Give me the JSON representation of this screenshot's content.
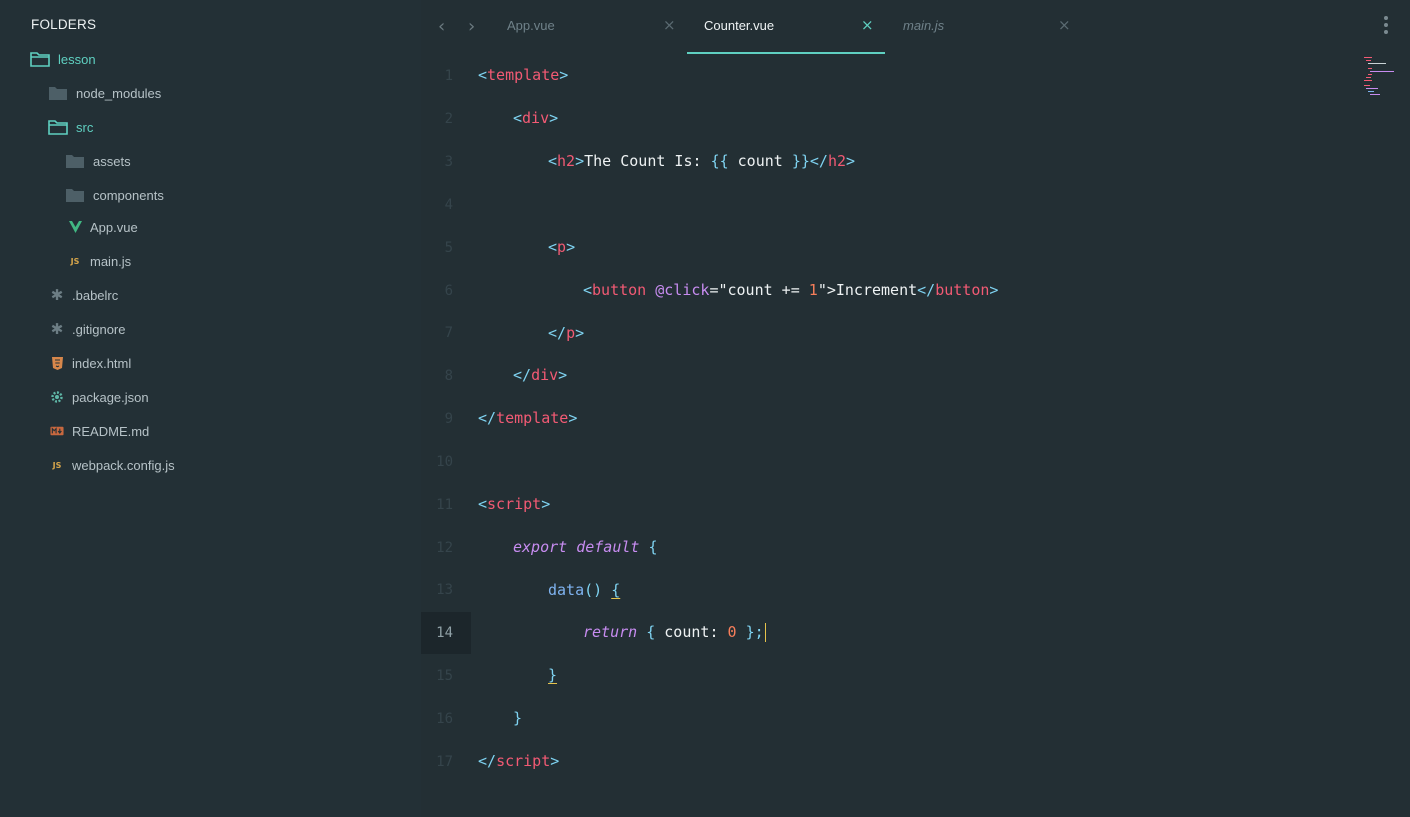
{
  "sidebar": {
    "title": "FOLDERS",
    "items": [
      {
        "label": "lesson",
        "icon": "folder-open-icon"
      },
      {
        "label": "node_modules",
        "icon": "folder-icon"
      },
      {
        "label": "src",
        "icon": "folder-open-icon"
      },
      {
        "label": "assets",
        "icon": "folder-icon"
      },
      {
        "label": "components",
        "icon": "folder-icon"
      },
      {
        "label": "App.vue",
        "icon": "vue-icon"
      },
      {
        "label": "main.js",
        "icon": "js-icon"
      },
      {
        "label": ".babelrc",
        "icon": "asterisk-icon"
      },
      {
        "label": ".gitignore",
        "icon": "asterisk-icon"
      },
      {
        "label": "index.html",
        "icon": "html5-icon"
      },
      {
        "label": "package.json",
        "icon": "gear-icon"
      },
      {
        "label": "README.md",
        "icon": "markdown-icon"
      },
      {
        "label": "webpack.config.js",
        "icon": "js-icon"
      }
    ]
  },
  "tabs": [
    {
      "label": "App.vue",
      "close": "×",
      "active": false
    },
    {
      "label": "Counter.vue",
      "close": "×",
      "active": true
    },
    {
      "label": "main.js",
      "close": "×",
      "active": false
    }
  ],
  "nav": {
    "back": "‹",
    "forward": "›"
  },
  "editor": {
    "line_numbers": [
      "1",
      "2",
      "3",
      "4",
      "5",
      "6",
      "7",
      "8",
      "9",
      "10",
      "11",
      "12",
      "13",
      "14",
      "15",
      "16",
      "17"
    ],
    "current_line": "14",
    "code": {
      "l1": {
        "a": "<",
        "b": "template",
        "c": ">"
      },
      "l2": {
        "a": "<",
        "b": "div",
        "c": ">"
      },
      "l3": {
        "a": "<",
        "b": "h2",
        "c": ">",
        "d": "The Count Is: ",
        "e": "{{",
        "f": " count ",
        "g": "}}",
        "h": "</",
        "i": "h2",
        "j": ">"
      },
      "l5": {
        "a": "<",
        "b": "p",
        "c": ">"
      },
      "l6": {
        "a": "<",
        "b": "button",
        "c": " ",
        "d": "@click",
        "e": "=\"",
        "f": "count += ",
        "g": "1",
        "h": "\">",
        "i": "Increment",
        "j": "</",
        "k": "button",
        "l": ">"
      },
      "l7": {
        "a": "</",
        "b": "p",
        "c": ">"
      },
      "l8": {
        "a": "</",
        "b": "div",
        "c": ">"
      },
      "l9": {
        "a": "</",
        "b": "template",
        "c": ">"
      },
      "l11": {
        "a": "<",
        "b": "script",
        "c": ">"
      },
      "l12": {
        "a": "export default",
        "b": " ",
        "c": "{"
      },
      "l13": {
        "a": "data",
        "b": "()",
        "c": " ",
        "d": "{"
      },
      "l14": {
        "a": "return",
        "b": " ",
        "c": "{",
        "d": " count",
        "e": ": ",
        "f": "0",
        "g": " ",
        "h": "}",
        "i": ";"
      },
      "l15": {
        "a": "}"
      },
      "l16": {
        "a": "}"
      },
      "l17": {
        "a": "</",
        "b": "script",
        "c": ">"
      }
    }
  },
  "colors": {
    "accent": "#5fd0c1",
    "background": "#232f34",
    "tag": "#f25a74",
    "keyword": "#c78cf0",
    "number": "#f77e5a"
  }
}
